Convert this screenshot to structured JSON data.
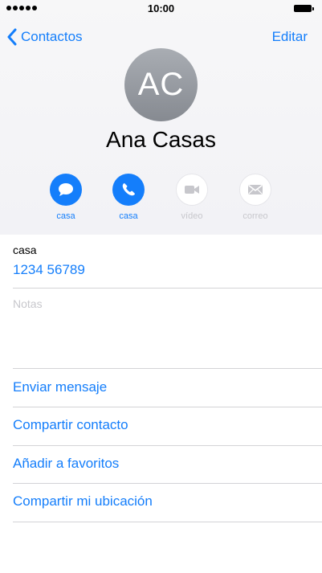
{
  "status_bar": {
    "time": "10:00"
  },
  "nav": {
    "back_label": "Contactos",
    "edit_label": "Editar"
  },
  "contact": {
    "initials": "AC",
    "name": "Ana Casas"
  },
  "actions": [
    {
      "label": "casa",
      "icon": "message-icon",
      "enabled": true
    },
    {
      "label": "casa",
      "icon": "phone-icon",
      "enabled": true
    },
    {
      "label": "vídeo",
      "icon": "video-icon",
      "enabled": false
    },
    {
      "label": "correo",
      "icon": "mail-icon",
      "enabled": false
    }
  ],
  "phone": {
    "label": "casa",
    "number": "1234 56789"
  },
  "notes": {
    "placeholder": "Notas"
  },
  "links": [
    "Enviar mensaje",
    "Compartir contacto",
    "Añadir a favoritos",
    "Compartir mi ubicación"
  ],
  "colors": {
    "accent": "#147efb",
    "disabled": "#c7c7cc",
    "separator": "#d3d3d6"
  }
}
